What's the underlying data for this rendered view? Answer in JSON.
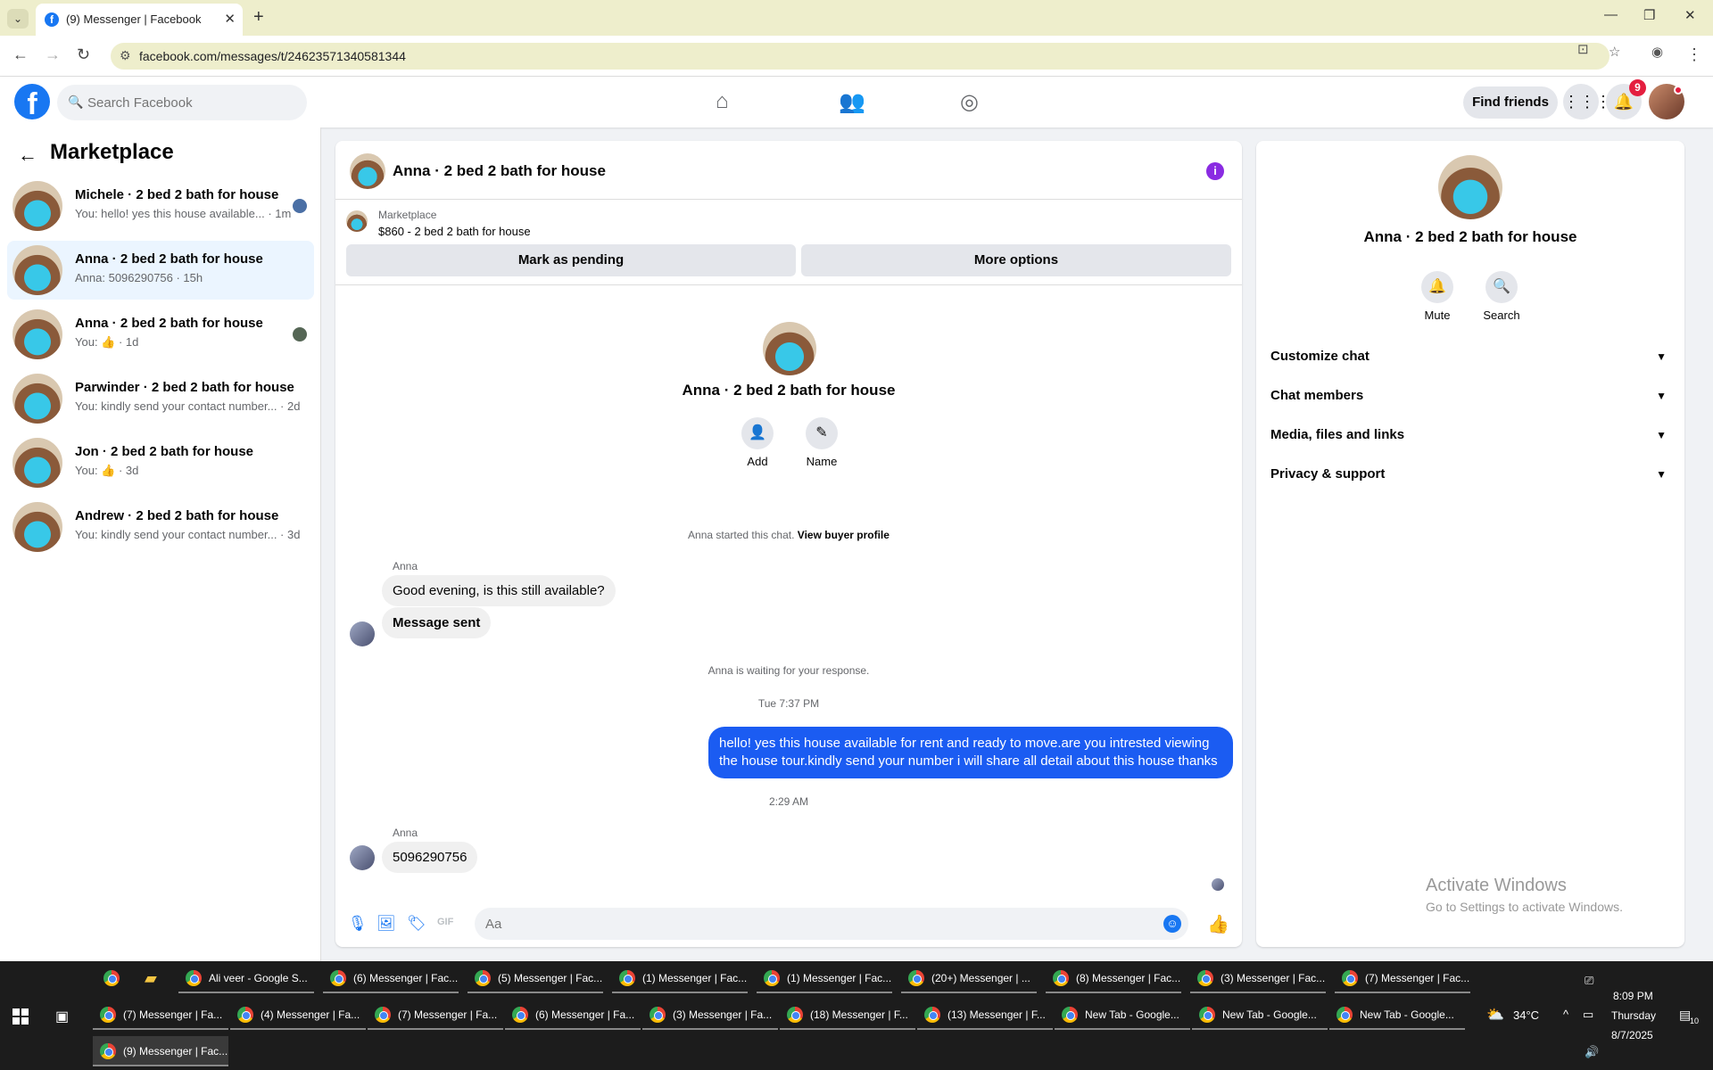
{
  "browser": {
    "tab_title": "(9) Messenger | Facebook",
    "url": "facebook.com/messages/t/24623571340581344",
    "favicon_letter": "f"
  },
  "fb_header": {
    "logo_letter": "f",
    "search_placeholder": "Search Facebook",
    "find_friends": "Find friends",
    "notification_count": "9"
  },
  "sidebar": {
    "title": "Marketplace",
    "conversations": [
      {
        "name": "Michele · 2 bed 2 bath for house",
        "sub": "You: hello! yes this house available... · 1m"
      },
      {
        "name": "Anna · 2 bed 2 bath for house",
        "sub": "Anna: 5096290756 · 15h"
      },
      {
        "name": "Anna · 2 bed 2 bath for house",
        "sub": "You: 👍 · 1d"
      },
      {
        "name": "Parwinder · 2 bed 2 bath for house",
        "sub": "You: kindly send your contact number... · 2d"
      },
      {
        "name": "Jon · 2 bed 2 bath for house",
        "sub": "You: 👍 · 3d"
      },
      {
        "name": "Andrew · 2 bed 2 bath for house",
        "sub": "You: kindly send your contact number... · 3d"
      }
    ]
  },
  "chat": {
    "title": "Anna · 2 bed 2 bath for house",
    "listing_label": "Marketplace",
    "listing_desc": "$860 - 2 bed 2 bath for house",
    "mark_pending": "Mark as pending",
    "more_options": "More options",
    "center_name": "Anna · 2 bed 2 bath for house",
    "add_label": "Add",
    "name_label": "Name",
    "started_text": "Anna started this chat.",
    "view_buyer": "View buyer profile",
    "sender1": "Anna",
    "msg1": "Good evening, is this still available?",
    "msg2": "Message sent",
    "waiting": "Anna is waiting for your response.",
    "time1": "Tue 7:37 PM",
    "out_msg": "hello! yes this house available for rent and ready to move.are you intrested viewing the house tour.kindly send your number i will share all detail about this house thanks",
    "time2": "2:29 AM",
    "sender2": "Anna",
    "msg3": "5096290756",
    "composer_placeholder": "Aa"
  },
  "right_panel": {
    "name": "Anna · 2 bed 2 bath for house",
    "mute": "Mute",
    "search": "Search",
    "rows": [
      "Customize chat",
      "Chat members",
      "Media, files and links",
      "Privacy & support"
    ],
    "watermark_title": "Activate Windows",
    "watermark_sub": "Go to Settings to activate Windows."
  },
  "taskbar": {
    "row1": [
      "Ali veer - Google S...",
      "(6) Messenger | Fac...",
      "(5) Messenger | Fac...",
      "(1) Messenger | Fac...",
      "(1) Messenger | Fac...",
      "(20+) Messenger | ...",
      "(8) Messenger | Fac...",
      "(3) Messenger | Fac...",
      "(7) Messenger | Fac..."
    ],
    "row2": [
      "(7) Messenger | Fa...",
      "(4) Messenger | Fa...",
      "(7) Messenger | Fa...",
      "(6) Messenger | Fa...",
      "(3) Messenger | Fa...",
      "(18) Messenger | F...",
      "(13) Messenger | F...",
      "New Tab - Google...",
      "New Tab - Google...",
      "New Tab - Google..."
    ],
    "row3": [
      "(9) Messenger | Fac..."
    ],
    "weather": "34°C",
    "time": "8:09 PM",
    "day": "Thursday",
    "date": "8/7/2025",
    "notif_count": "10"
  },
  "colors": {
    "fb_blue": "#1877f2",
    "outgoing_bubble": "#1b5cf2",
    "active_conversation": "#ebf5ff",
    "info_icon": "#8a2be2"
  }
}
